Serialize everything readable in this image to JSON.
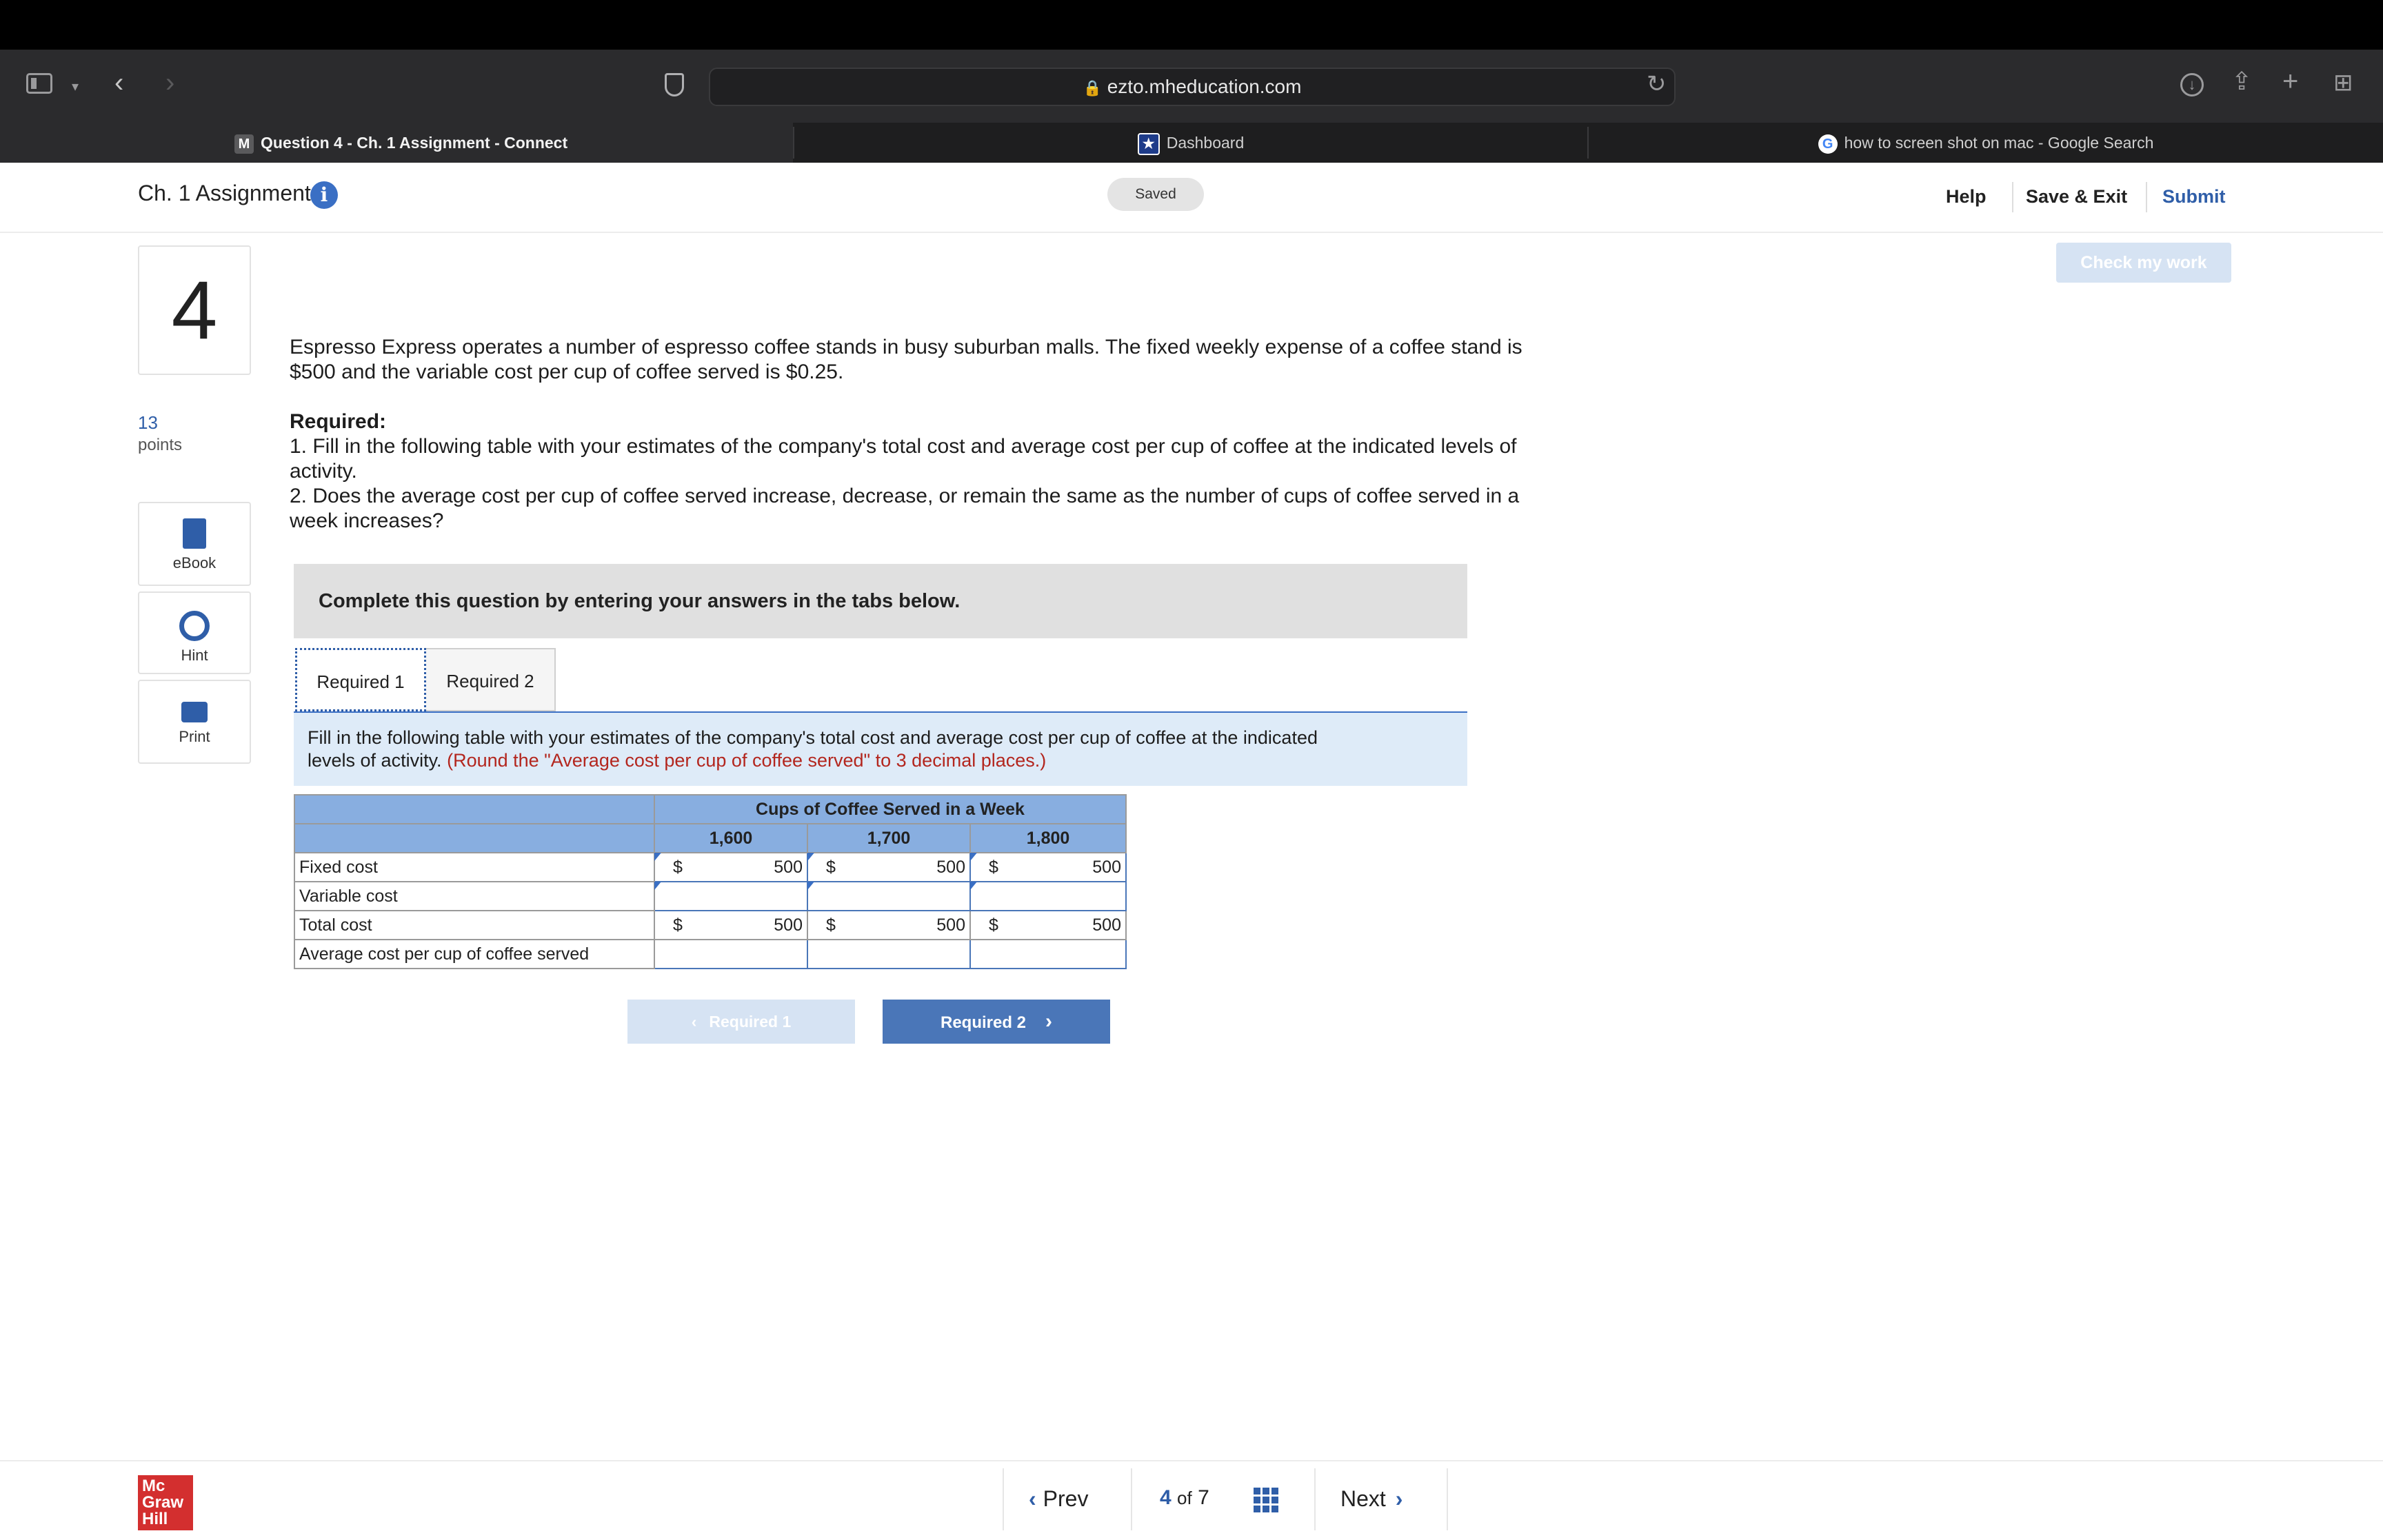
{
  "browser": {
    "url": "ezto.mheducation.com",
    "tabs": [
      {
        "favicon": "M",
        "title": "Question 4 - Ch. 1 Assignment - Connect",
        "active": true
      },
      {
        "favicon": "★",
        "title": "Dashboard",
        "active": false
      },
      {
        "favicon": "G",
        "title": "how to screen shot on mac - Google Search",
        "active": false
      }
    ]
  },
  "header": {
    "title": "Ch. 1 Assignment",
    "saved": "Saved",
    "help": "Help",
    "save_exit": "Save & Exit",
    "submit": "Submit",
    "check_my_work": "Check my work"
  },
  "question": {
    "number": "4",
    "points_value": "13",
    "points_label": "points",
    "tools": [
      {
        "label": "eBook",
        "icon": "book-icon"
      },
      {
        "label": "Hint",
        "icon": "lifebuoy-icon"
      },
      {
        "label": "Print",
        "icon": "printer-icon"
      }
    ],
    "intro_line1": "Espresso Express operates a number of espresso coffee stands in busy suburban malls. The fixed weekly expense of a coffee stand is",
    "intro_line2": "$500 and the variable cost per cup of coffee served is $0.25.",
    "required_heading": "Required:",
    "req1_line1": "1. Fill in the following table with your estimates of the company's total cost and average cost per cup of coffee at the indicated levels of",
    "req1_line2": "activity.",
    "req2_line1": "2. Does the average cost per cup of coffee served increase, decrease, or remain the same as the number of cups of coffee served in a",
    "req2_line2": "week increases?",
    "instruction_box": "Complete this question by entering your answers in the tabs below.",
    "tabs": [
      "Required 1",
      "Required 2"
    ],
    "fill_line1": "Fill in the following table with your estimates of the company's total cost and average cost per cup of coffee at the indicated",
    "fill_line2": "levels of activity.",
    "fill_red": "(Round the \"Average cost per cup of coffee served\" to 3 decimal places.)"
  },
  "table": {
    "group_header": "Cups of Coffee Served in a Week",
    "columns": [
      "1,600",
      "1,700",
      "1,800"
    ],
    "currency": "$",
    "rows": [
      {
        "label": "Fixed cost",
        "values": [
          "500",
          "500",
          "500"
        ]
      },
      {
        "label": "Variable cost",
        "values": [
          "",
          "",
          ""
        ]
      },
      {
        "label": "Total cost",
        "values": [
          "500",
          "500",
          "500"
        ]
      },
      {
        "label": "Average cost per cup of coffee served",
        "values": [
          "",
          "",
          ""
        ]
      }
    ]
  },
  "nav": {
    "prev_req": "Required 1",
    "next_req": "Required 2",
    "prev": "Prev",
    "current": "4",
    "of": "of",
    "total": "7",
    "next": "Next"
  },
  "footer": {
    "logo_l1": "Mc",
    "logo_l2": "Graw",
    "logo_l3": "Hill"
  },
  "colors": {
    "accent": "#3a6fc4",
    "table_header": "#88aee0",
    "instruction_red": "#b3261e",
    "logo_red": "#d32f2f"
  }
}
